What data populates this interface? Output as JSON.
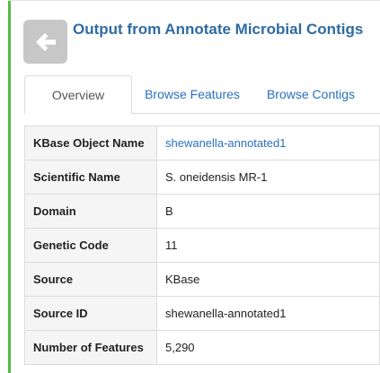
{
  "header": {
    "title": "Output from Annotate Microbial Contigs",
    "back_icon": "arrow-left-icon"
  },
  "tabs": [
    {
      "label": "Overview",
      "active": true
    },
    {
      "label": "Browse Features",
      "active": false
    },
    {
      "label": "Browse Contigs",
      "active": false
    }
  ],
  "rows": [
    {
      "label": "KBase Object Name",
      "value": "shewanella-annotated1",
      "link": true
    },
    {
      "label": "Scientific Name",
      "value": "S. oneidensis MR-1",
      "link": false
    },
    {
      "label": "Domain",
      "value": "B",
      "link": false
    },
    {
      "label": "Genetic Code",
      "value": "11",
      "link": false
    },
    {
      "label": "Source",
      "value": "KBase",
      "link": false
    },
    {
      "label": "Source ID",
      "value": "shewanella-annotated1",
      "link": false
    },
    {
      "label": "Number of Features",
      "value": "5,290",
      "link": false
    }
  ],
  "colors": {
    "accent": "#55b847",
    "title": "#2f6ba3",
    "link": "#2a6fbf",
    "button": "#c7c7c7"
  }
}
